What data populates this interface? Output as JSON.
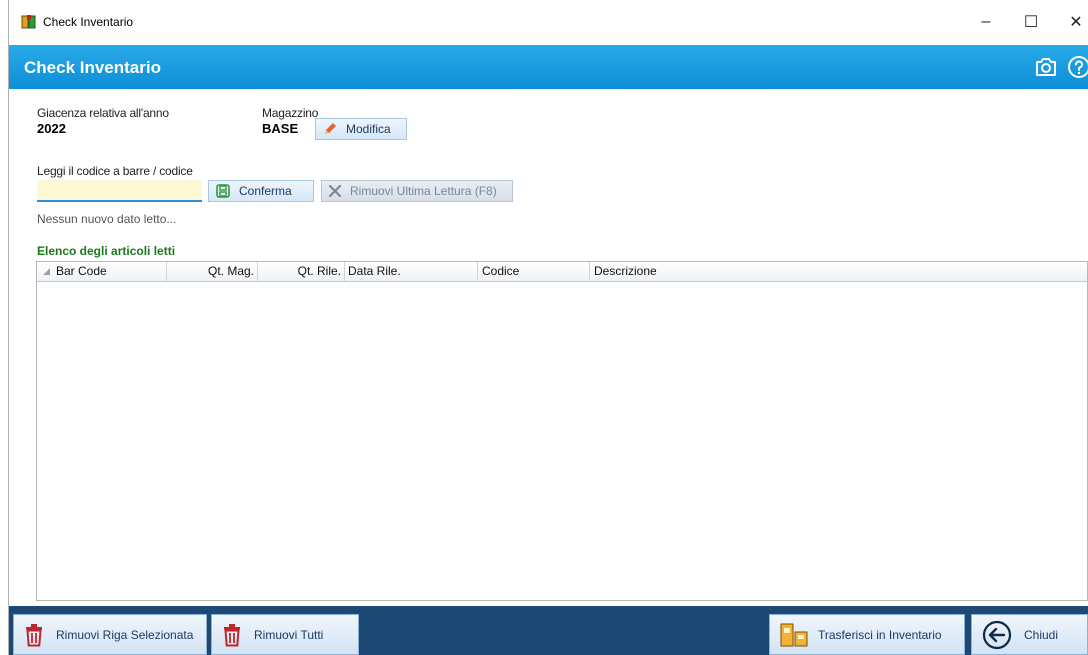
{
  "window": {
    "title": "Check Inventario",
    "minimize": "–",
    "maximize": "☐",
    "close": "✕"
  },
  "header": {
    "title": "Check Inventario",
    "icons": [
      "camera-icon",
      "help-icon"
    ]
  },
  "info": {
    "year_label": "Giacenza relativa all'anno",
    "year_value": "2022",
    "warehouse_label": "Magazzino",
    "warehouse_value": "BASE",
    "modify_button": "Modifica"
  },
  "scan": {
    "label": "Leggi il codice a barre / codice",
    "input_value": "",
    "input_placeholder": "",
    "confirm_button": "Conferma",
    "remove_last_button": "Rimuovi Ultima Lettura (F8)",
    "status": "Nessun nuovo dato letto..."
  },
  "list": {
    "title": "Elenco degli articoli letti",
    "columns": [
      "Bar Code",
      "Qt. Mag.",
      "Qt. Rile.",
      "Data Rile.",
      "Codice",
      "Descrizione"
    ],
    "rows": []
  },
  "footer": {
    "remove_selected": "Rimuovi Riga Selezionata",
    "remove_all": "Rimuovi Tutti",
    "transfer": "Trasferisci in Inventario",
    "close": "Chiudi"
  },
  "colors": {
    "header_blue": "#0b8fd6",
    "footer_navy": "#1c4a75",
    "section_green": "#1a7a1a",
    "input_yellow": "#fff8d6"
  }
}
